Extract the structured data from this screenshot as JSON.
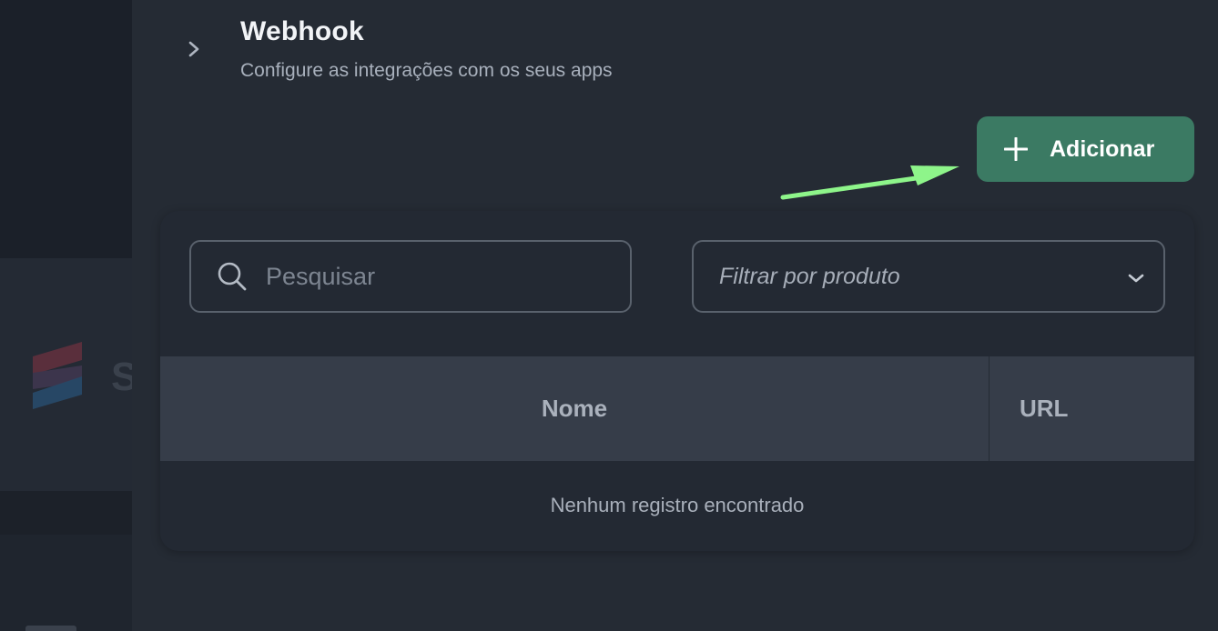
{
  "header": {
    "title": "Webhook",
    "subtitle": "Configure as integrações com os seus apps",
    "chevron_icon": "chevron-right-icon"
  },
  "actions": {
    "add_label": "Adicionar",
    "add_icon": "plus-icon",
    "add_color": "#3b7a63"
  },
  "annotation": {
    "arrow_color": "#8ef58a",
    "arrow_icon": "arrow-annotation-icon"
  },
  "filters": {
    "search_placeholder": "Pesquisar",
    "search_icon": "search-icon",
    "product_filter_label": "Filtrar por produto",
    "product_filter_icon": "chevron-down-icon"
  },
  "table": {
    "columns": [
      "Nome",
      "URL"
    ],
    "empty_message": "Nenhum registro encontrado"
  },
  "background": {
    "brand_letter": "S"
  }
}
